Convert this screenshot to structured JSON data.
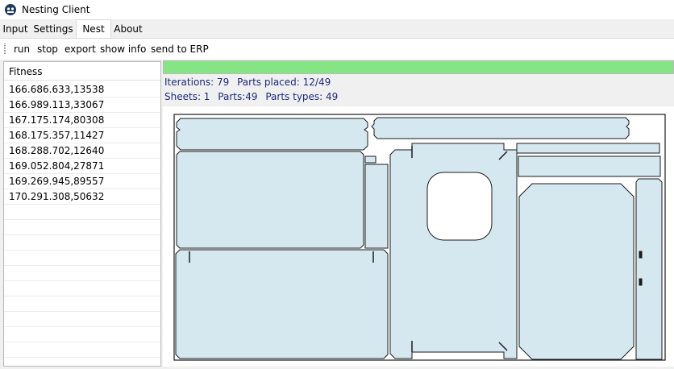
{
  "window": {
    "title": "Nesting Client",
    "icon": "app-icon"
  },
  "tabs": [
    {
      "label": "Input",
      "active": false
    },
    {
      "label": "Settings",
      "active": false
    },
    {
      "label": "Nest",
      "active": true
    },
    {
      "label": "About",
      "active": false
    }
  ],
  "toolbar": {
    "run": "run",
    "stop": "stop",
    "export": "export",
    "show_info": "show info",
    "send_to_erp": "send to ERP"
  },
  "fitness": {
    "header": "Fitness",
    "rows": [
      "166.686.633,13538",
      "166.989.113,33067",
      "167.175.174,80308",
      "168.175.357,11427",
      "168.288.702,12640",
      "169.052.804,27871",
      "169.269.945,89557",
      "170.291.308,50632"
    ]
  },
  "progress": {
    "value": 1.0,
    "fill_color": "#85e585"
  },
  "info": {
    "iterations": "Iterations: 79",
    "parts_placed": "Parts placed: 12/49",
    "sheets": "Sheets: 1",
    "parts": "Parts:49",
    "part_types": "Parts types: 49"
  },
  "colors": {
    "part_fill": "#d5e8f0",
    "part_stroke": "#1a1a1a",
    "info_text": "#1c2a7a"
  }
}
